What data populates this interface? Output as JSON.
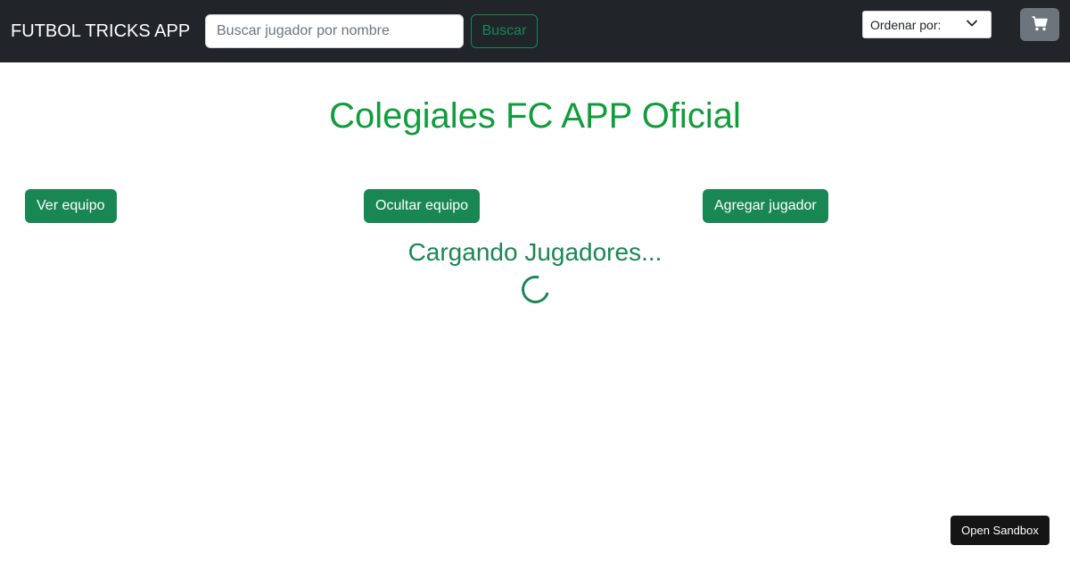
{
  "navbar": {
    "brand": "FUTBOL TRICKS APP",
    "search_placeholder": "Buscar jugador por nombre",
    "search_label": "Buscar",
    "sort_label": "Ordenar por:",
    "cart_icon": "cart-icon"
  },
  "main": {
    "title": "Colegiales FC APP Oficial",
    "buttons": {
      "ver": "Ver equipo",
      "ocultar": "Ocultar equipo",
      "agregar": "Agregar jugador"
    },
    "loading_text": "Cargando Jugadores..."
  },
  "sandbox": {
    "label": "Open Sandbox"
  },
  "colors": {
    "navbar_bg": "#212529",
    "accent_green": "#198754",
    "title_green": "#0f9d3a",
    "cart_bg": "#6c757d"
  }
}
